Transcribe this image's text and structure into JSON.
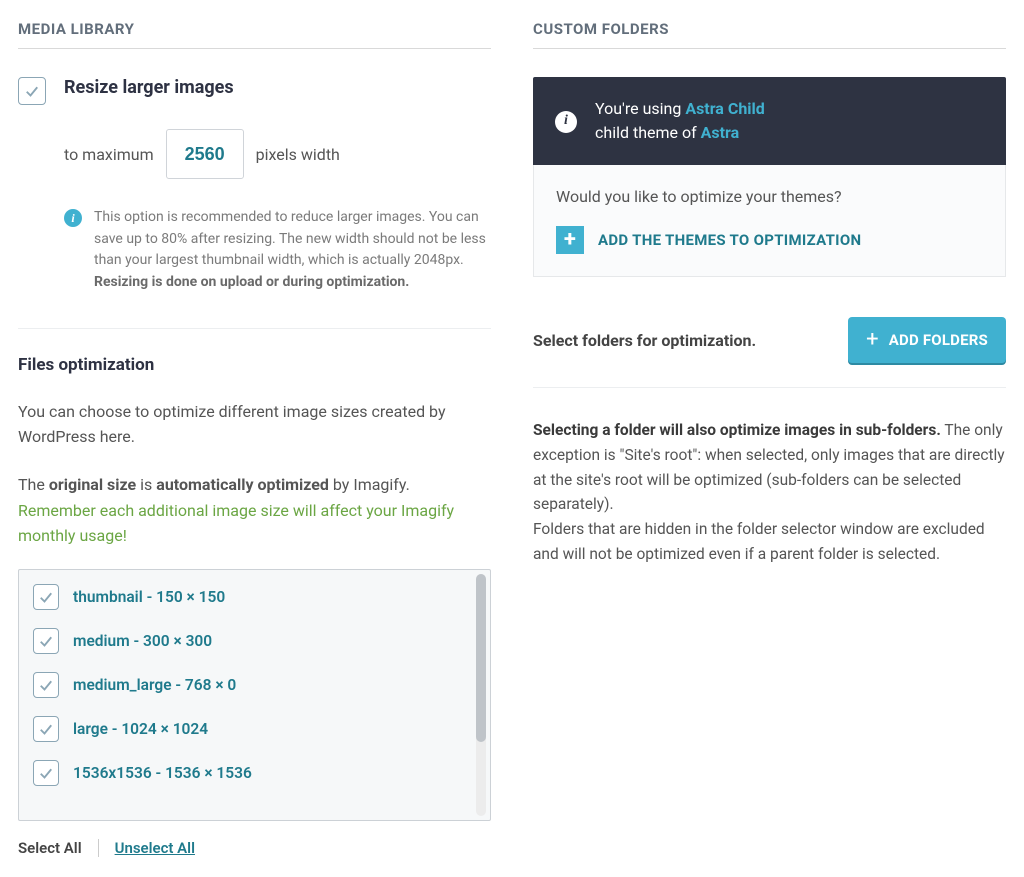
{
  "media_library": {
    "heading": "Media Library",
    "resize": {
      "label": "Resize larger images",
      "prefix": "to maximum",
      "value": "2560",
      "suffix": "pixels width"
    },
    "info": {
      "text": "This option is recommended to reduce larger images. You can save up to 80% after resizing. The new width should not be less than your largest thumbnail width, which is actually 2048px.",
      "strong": "Resizing is done on upload or during optimization."
    },
    "files": {
      "heading": "Files optimization",
      "lead": "You can choose to optimize different image sizes created by WordPress here.",
      "line2_pre": "The ",
      "line2_s1": "original size",
      "line2_mid": " is ",
      "line2_s2": "automatically optimized",
      "line2_post": " by Imagify.",
      "warn": "Remember each additional image size will affect your Imagify monthly usage!"
    },
    "sizes": [
      "thumbnail - 150 × 150",
      "medium - 300 × 300",
      "medium_large - 768 × 0",
      "large - 1024 × 1024",
      "1536x1536 - 1536 × 1536"
    ],
    "select_all": "Select All",
    "unselect_all": "Unselect All"
  },
  "custom_folders": {
    "heading": "Custom Folders",
    "theme": {
      "pre": "You're using ",
      "child": "Astra Child",
      "mid": "child theme of ",
      "parent": "Astra"
    },
    "question": "Would you like to optimize your themes?",
    "add_themes": "ADD THE THEMES TO OPTIMIZATION",
    "select_folders": "Select folders for optimization.",
    "add_folders": "ADD FOLDERS",
    "desc_strong": "Selecting a folder will also optimize images in sub-folders.",
    "desc_rest": " The only exception is \"Site's root\": when selected, only images that are directly at the site's root will be optimized (sub-folders can be selected separately).",
    "desc_p2": "Folders that are hidden in the folder selector window are excluded and will not be optimized even if a parent folder is selected."
  }
}
